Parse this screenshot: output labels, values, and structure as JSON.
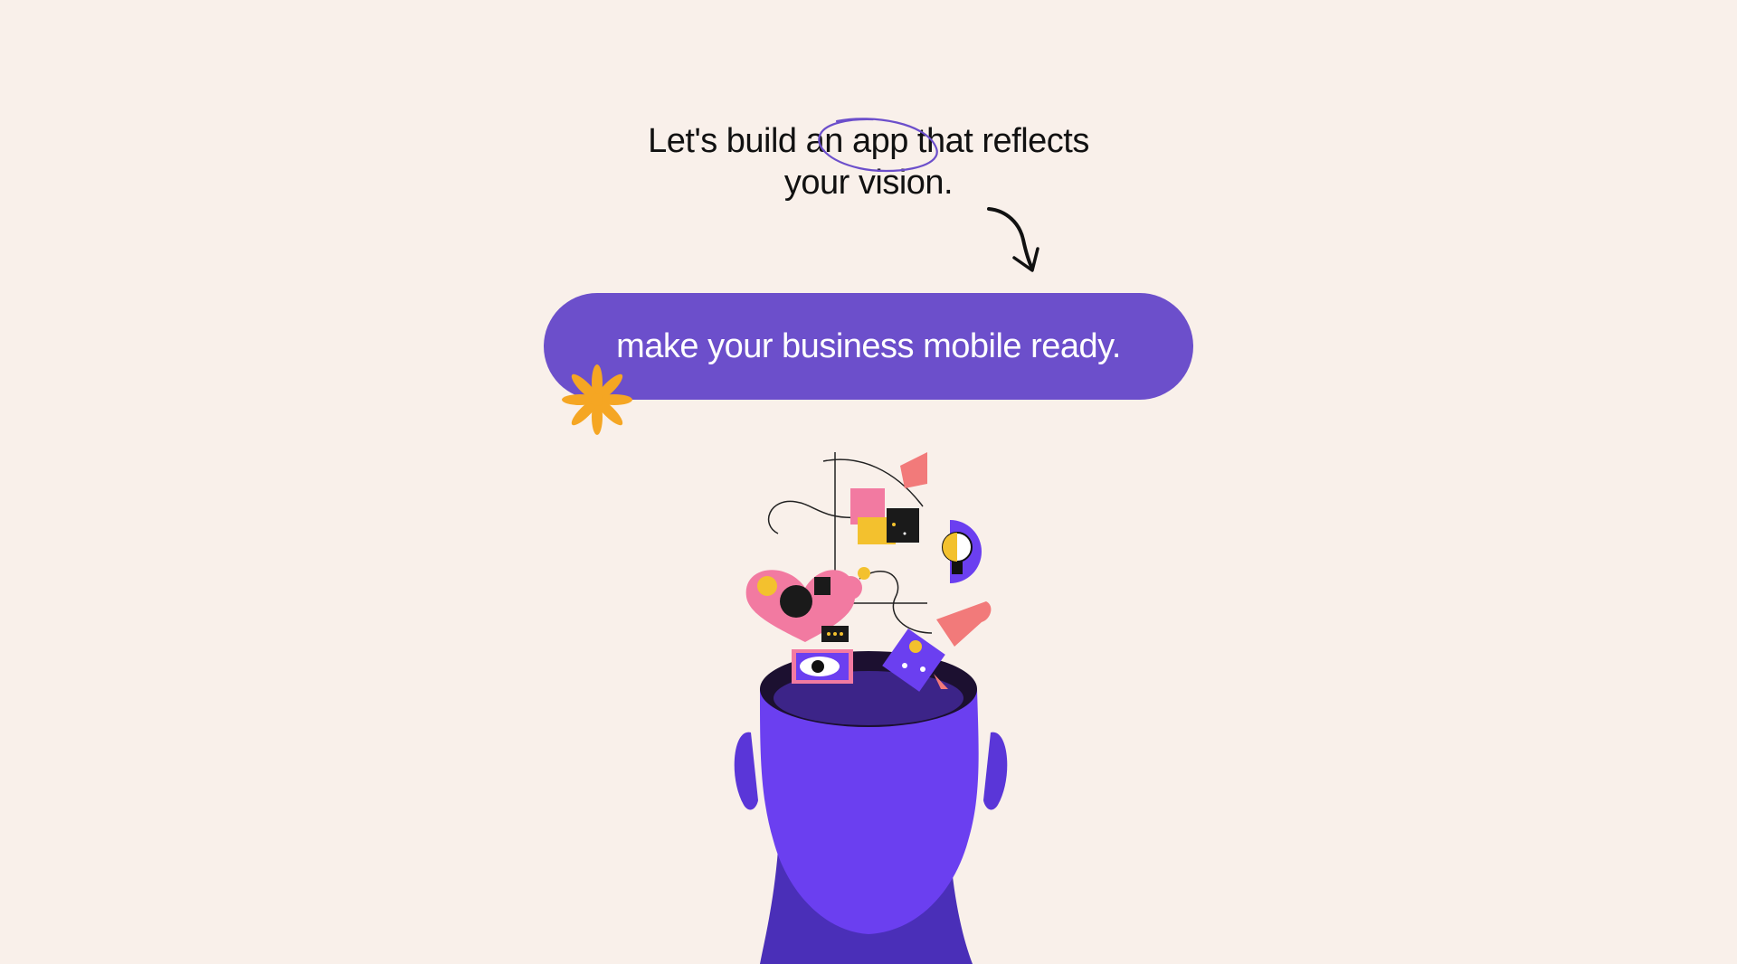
{
  "hero": {
    "headline_line1_pre": "Let's build an ",
    "headline_line1_highlight": "app",
    "headline_line1_post": " that reflects",
    "headline_line2": "your vision.",
    "cta_label": "make your business mobile ready."
  },
  "colors": {
    "background": "#f9f0ea",
    "accent_purple": "#6c4fcb",
    "head_purple": "#6b3ff0",
    "flower_orange": "#f5a623",
    "text": "#111111"
  },
  "icons": [
    "circle-scribble-icon",
    "curved-arrow-icon",
    "asterisk-flower-icon",
    "head-illustration"
  ]
}
